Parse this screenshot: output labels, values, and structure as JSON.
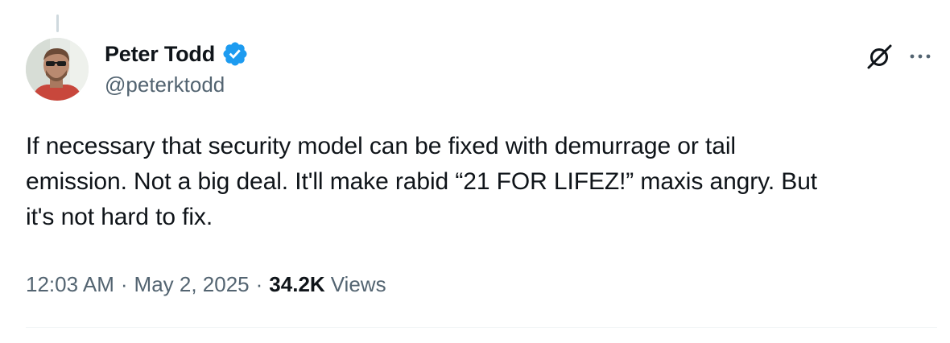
{
  "author": {
    "display_name": "Peter Todd",
    "handle": "@peterktodd",
    "verified": true,
    "verified_badge_color": "#1d9bf0"
  },
  "header_actions": {
    "grok_icon": "grok-icon",
    "more_icon": "more-options-icon",
    "more_label": "···"
  },
  "tweet": {
    "text_lines": [
      "If necessary that security model can be fixed with demurrage or tail",
      "emission. Not a big deal. It'll make rabid “21 FOR LIFEZ!” maxis angry. But",
      "it's not hard to fix."
    ]
  },
  "meta": {
    "time": "12:03 AM",
    "separator": "·",
    "date": "May 2, 2025",
    "views_count": "34.2K",
    "views_label": "Views"
  },
  "colors": {
    "text_primary": "#0f1419",
    "text_secondary": "#536471",
    "divider": "#eff3f4",
    "thread_line": "#cfd9de"
  }
}
